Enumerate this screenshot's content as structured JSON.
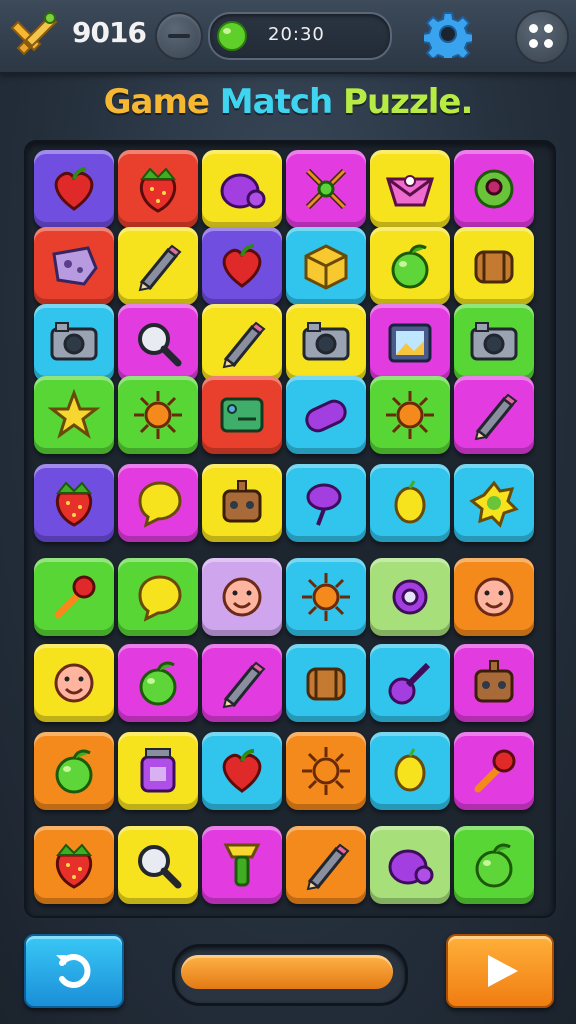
{
  "header": {
    "score": "9016",
    "progress_text": "20:30"
  },
  "title": {
    "part1": "Game ",
    "part2": "Match ",
    "part3": "Puzzle."
  },
  "progress_bar": {
    "fill_fraction": 1.0
  },
  "colors": {
    "purple": "#6f4ee0",
    "red": "#e8402c",
    "yellow": "#f7e21e",
    "magenta": "#e23ce0",
    "cyan": "#31c4ec",
    "green": "#58d636",
    "orange": "#f58a1c",
    "lightgreen": "#a7e07a",
    "lavender": "#cfa6ee"
  },
  "board": {
    "rows": [
      [
        {
          "bg": "purple",
          "icon": "heart"
        },
        {
          "bg": "red",
          "icon": "strawberry"
        },
        {
          "bg": "yellow",
          "icon": "blob"
        },
        {
          "bg": "magenta",
          "icon": "windmill"
        },
        {
          "bg": "yellow",
          "icon": "envelope"
        },
        {
          "bg": "magenta",
          "icon": "donut"
        }
      ],
      [
        {
          "bg": "red",
          "icon": "cookie"
        },
        {
          "bg": "yellow",
          "icon": "pencil"
        },
        {
          "bg": "purple",
          "icon": "heart"
        },
        {
          "bg": "cyan",
          "icon": "cube"
        },
        {
          "bg": "yellow",
          "icon": "apple"
        },
        {
          "bg": "yellow",
          "icon": "barrel"
        }
      ],
      [
        {
          "bg": "cyan",
          "icon": "camera"
        },
        {
          "bg": "magenta",
          "icon": "magnifier"
        },
        {
          "bg": "yellow",
          "icon": "pencil"
        },
        {
          "bg": "yellow",
          "icon": "camera"
        },
        {
          "bg": "magenta",
          "icon": "frame"
        },
        {
          "bg": "green",
          "icon": "camera"
        }
      ],
      [
        {
          "bg": "green",
          "icon": "star"
        },
        {
          "bg": "green",
          "icon": "sun"
        },
        {
          "bg": "red",
          "icon": "board"
        },
        {
          "bg": "cyan",
          "icon": "capsule"
        },
        {
          "bg": "green",
          "icon": "sun"
        },
        {
          "bg": "magenta",
          "icon": "pencil"
        }
      ],
      [
        {
          "bg": "purple",
          "icon": "strawberry"
        },
        {
          "bg": "magenta",
          "icon": "bubble"
        },
        {
          "bg": "yellow",
          "icon": "robot"
        },
        {
          "bg": "cyan",
          "icon": "lollipop"
        },
        {
          "bg": "cyan",
          "icon": "lemon"
        },
        {
          "bg": "cyan",
          "icon": "splat"
        }
      ],
      [
        {
          "bg": "green",
          "icon": "wand"
        },
        {
          "bg": "green",
          "icon": "bubble"
        },
        {
          "bg": "lavender",
          "icon": "face"
        },
        {
          "bg": "cyan",
          "icon": "sun"
        },
        {
          "bg": "lightgreen",
          "icon": "gear"
        },
        {
          "bg": "orange",
          "icon": "face"
        }
      ],
      [
        {
          "bg": "yellow",
          "icon": "face"
        },
        {
          "bg": "magenta",
          "icon": "apple"
        },
        {
          "bg": "magenta",
          "icon": "pencil"
        },
        {
          "bg": "cyan",
          "icon": "barrel"
        },
        {
          "bg": "cyan",
          "icon": "guitar"
        },
        {
          "bg": "magenta",
          "icon": "robot"
        }
      ],
      [
        {
          "bg": "orange",
          "icon": "apple"
        },
        {
          "bg": "yellow",
          "icon": "jar"
        },
        {
          "bg": "cyan",
          "icon": "heart"
        },
        {
          "bg": "orange",
          "icon": "sun"
        },
        {
          "bg": "cyan",
          "icon": "lemon"
        },
        {
          "bg": "magenta",
          "icon": "wand"
        }
      ],
      [
        {
          "bg": "orange",
          "icon": "strawberry"
        },
        {
          "bg": "yellow",
          "icon": "magnifier"
        },
        {
          "bg": "magenta",
          "icon": "cup"
        },
        {
          "bg": "orange",
          "icon": "pencil"
        },
        {
          "bg": "lightgreen",
          "icon": "blob"
        },
        {
          "bg": "green",
          "icon": "apple"
        }
      ]
    ]
  }
}
